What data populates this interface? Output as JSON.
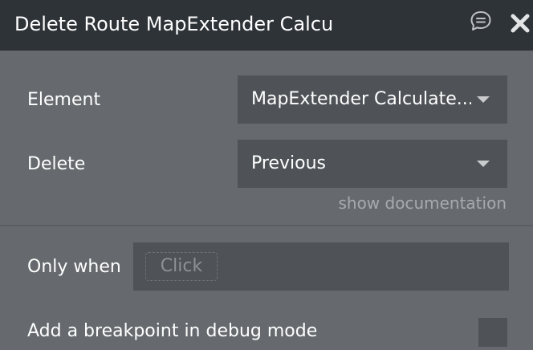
{
  "header": {
    "title": "Delete Route MapExtender Calcu",
    "comment_icon": "speech-bubble-icon",
    "close_icon": "close-x-icon"
  },
  "fields": {
    "element_label": "Element",
    "element_value": "MapExtender Calculate...",
    "delete_label": "Delete",
    "delete_value": "Previous",
    "show_documentation": "show documentation"
  },
  "condition": {
    "only_when_label": "Only when",
    "click_placeholder": "Click"
  },
  "debug": {
    "breakpoint_label": "Add a breakpoint in debug mode",
    "breakpoint_checked": false
  },
  "colors": {
    "titlebar": "#2e3338",
    "panel": "#666a6e",
    "field": "#4f5357",
    "muted_text": "#a7aaad"
  }
}
